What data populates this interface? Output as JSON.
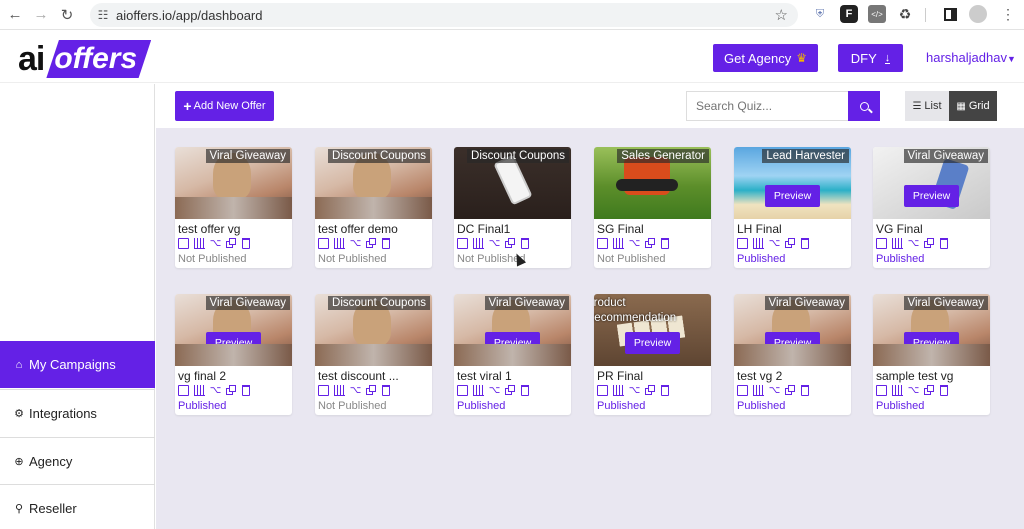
{
  "browser": {
    "url": "aioffers.io/app/dashboard",
    "icons": [
      "back-icon",
      "forward-icon",
      "reload-icon",
      "site-settings-icon",
      "bookmark-star-icon",
      "shield-extension-icon",
      "f-extension-icon",
      "code-extension-icon",
      "puzzle-extensions-icon",
      "side-panel-icon",
      "profile-avatar-icon",
      "menu-dots-icon"
    ]
  },
  "header": {
    "logo_ai": "ai",
    "logo_offers": "offers",
    "get_agency_label": "Get Agency",
    "dfy_label": "DFY",
    "username": "harshaljadhav"
  },
  "sidebar": {
    "items": [
      {
        "label": "My Campaigns",
        "icon": "home-icon",
        "active": true
      },
      {
        "label": "Integrations",
        "icon": "gear-icon",
        "active": false
      },
      {
        "label": "Agency",
        "icon": "crosshair-icon",
        "active": false
      },
      {
        "label": "Reseller",
        "icon": "pin-icon",
        "active": false
      }
    ]
  },
  "toolbar": {
    "add_label": "Add New Offer",
    "search_placeholder": "Search Quiz...",
    "list_label": "List",
    "grid_label": "Grid",
    "active_view": "Grid"
  },
  "cards": [
    {
      "tag": "Viral Giveaway",
      "title": "test offer vg",
      "status": "Not Published",
      "preview": ""
    },
    {
      "tag": "Discount Coupons",
      "title": "test offer demo",
      "status": "Not Published",
      "preview": ""
    },
    {
      "tag": "Discount Coupons",
      "title": "DC Final1",
      "status": "Not Published",
      "preview": ""
    },
    {
      "tag": "Sales Generator",
      "title": "SG Final",
      "status": "Not Published",
      "preview": ""
    },
    {
      "tag": "Lead Harvester",
      "title": "LH Final",
      "status": "Published",
      "preview": "Preview"
    },
    {
      "tag": "Viral Giveaway",
      "title": "VG Final",
      "status": "Published",
      "preview": "Preview"
    },
    {
      "tag": "Viral Giveaway",
      "title": "vg final 2",
      "status": "Published",
      "preview": "Preview"
    },
    {
      "tag": "Discount Coupons",
      "title": "test discount ...",
      "status": "Not Published",
      "preview": ""
    },
    {
      "tag": "Viral Giveaway",
      "title": "test viral 1",
      "status": "Published",
      "preview": "Preview"
    },
    {
      "tag": "Product Recommendation",
      "title": "PR Final",
      "status": "Published",
      "preview": "Preview"
    },
    {
      "tag": "Viral Giveaway",
      "title": "test vg 2",
      "status": "Published",
      "preview": "Preview"
    },
    {
      "tag": "Viral Giveaway",
      "title": "sample test vg",
      "status": "Published",
      "preview": "Preview"
    }
  ],
  "card_actions": [
    "edit-icon",
    "stats-icon",
    "share-icon",
    "copy-icon",
    "delete-icon"
  ],
  "colors": {
    "accent": "#6421e6",
    "content_bg": "#e9e7f1",
    "not_published": "#888888"
  }
}
